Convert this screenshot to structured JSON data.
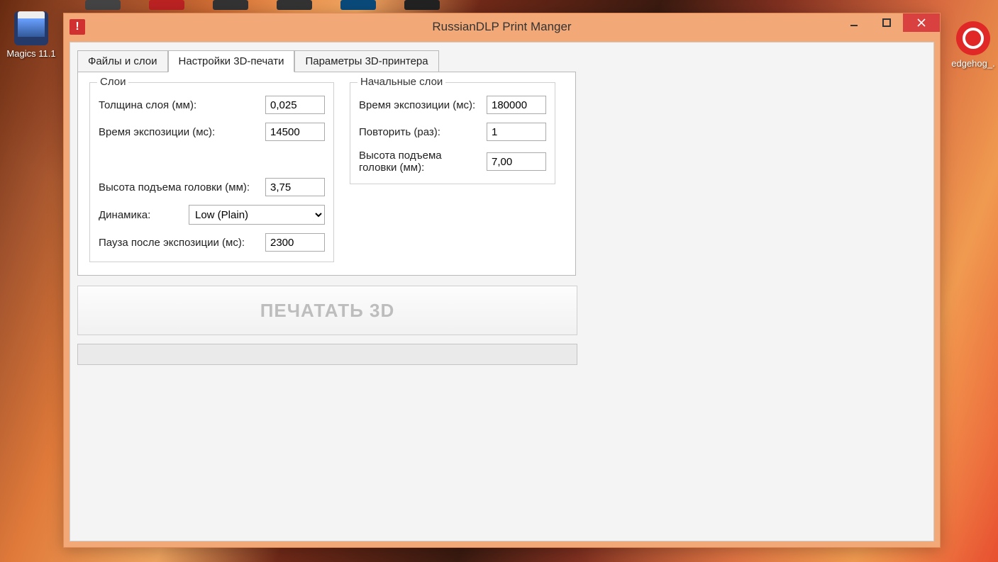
{
  "desktop": {
    "left_icon_label": "Magics 11.1",
    "right_icon_label": "edgehog_."
  },
  "window": {
    "title": "RussianDLP Print Manger",
    "app_icon_glyph": "!"
  },
  "tabs": {
    "t1": "Файлы и слои",
    "t2": "Настройки 3D-печати",
    "t3": "Параметры 3D-принтера"
  },
  "layers_group": {
    "title": "Слои",
    "thickness_label": "Толщина слоя (мм):",
    "thickness_value": "0,025",
    "exposure_label": "Время экспозиции (мс):",
    "exposure_value": "14500",
    "lift_label": "Высота подъема головки (мм):",
    "lift_value": "3,75",
    "dynamics_label": "Динамика:",
    "dynamics_value": "Low (Plain)",
    "pause_label": "Пауза после экспозиции (мс):",
    "pause_value": "2300"
  },
  "initial_group": {
    "title": "Начальные слои",
    "exposure_label": "Время экспозиции (мс):",
    "exposure_value": "180000",
    "repeat_label": "Повторить (раз):",
    "repeat_value": "1",
    "lift_label": "Высота подъема головки (мм):",
    "lift_value": "7,00"
  },
  "print_button": "ПЕЧАТАТЬ 3D"
}
